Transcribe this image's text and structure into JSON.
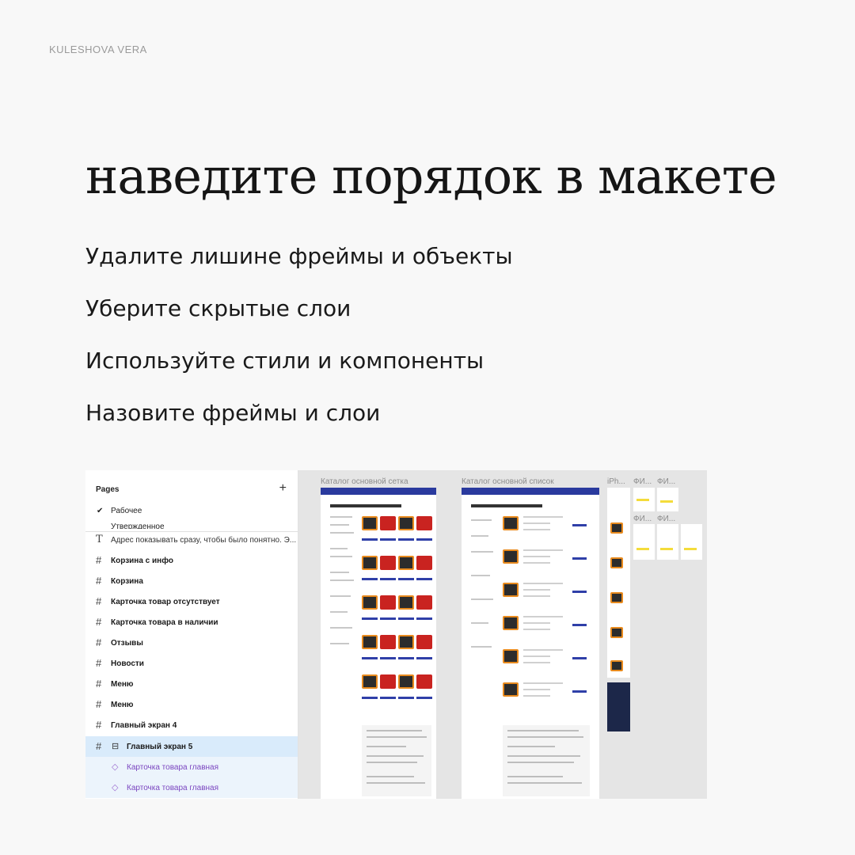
{
  "brand": "KULESHOVA VERA",
  "headline": "наведите порядок в макете",
  "tips": [
    "Удалите лишине фреймы и объекты",
    "Уберите скрытые слои",
    "Используйте стили и компоненты",
    "Назовите фреймы и слои"
  ],
  "figma": {
    "pages_title": "Pages",
    "pages": [
      {
        "label": "Рабочее",
        "current": true
      },
      {
        "label": "Утвержденное",
        "current": false
      }
    ],
    "layers": [
      {
        "icon": "text-icon",
        "label": "Адрес показывать сразу, чтобы было понятно. Э..."
      },
      {
        "icon": "frame-icon",
        "label": "Корзина с инфо"
      },
      {
        "icon": "frame-icon",
        "label": "Корзина"
      },
      {
        "icon": "frame-icon",
        "label": "Карточка товар отсутствует"
      },
      {
        "icon": "frame-icon",
        "label": "Карточка товара в наличии"
      },
      {
        "icon": "frame-icon",
        "label": "Отзывы"
      },
      {
        "icon": "frame-icon",
        "label": "Новости"
      },
      {
        "icon": "frame-icon",
        "label": "Меню"
      },
      {
        "icon": "frame-icon",
        "label": "Меню"
      },
      {
        "icon": "frame-icon",
        "label": "Главный экран 4"
      },
      {
        "icon": "frame-icon",
        "label": "Главный экран 5",
        "selected": true
      },
      {
        "icon": "component-instance-icon",
        "label": "Карточка товара главная",
        "child": true
      },
      {
        "icon": "component-instance-icon",
        "label": "Карточка товара главная",
        "child": true
      }
    ],
    "canvas_frames": [
      {
        "label": "Каталог основной сетка"
      },
      {
        "label": "Каталог основной список"
      },
      {
        "label": "iPh..."
      },
      {
        "label": "ФИ..."
      },
      {
        "label": "ФИ..."
      },
      {
        "label": "ФИ..."
      },
      {
        "label": "ФИ..."
      }
    ],
    "accent": "#2a3a9e",
    "selection": "#d9ebfb",
    "component": "#7b46c0"
  }
}
